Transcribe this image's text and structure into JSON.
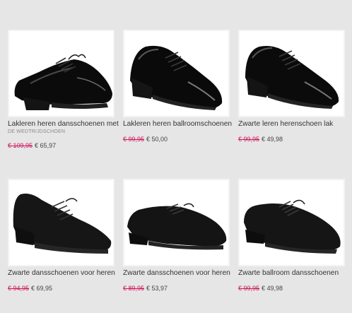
{
  "colors": {
    "sale": "#d1135a",
    "background": "#e6e6e6"
  },
  "products": [
    {
      "title": "Lakleren heren dansschoenen met",
      "subtitle": "DE WEDTRIJDSCHOEN",
      "old_price": "€ 109,95",
      "new_price": "€ 65,97",
      "image": "patent-oxford-shoe"
    },
    {
      "title": "Lakleren heren ballroomschoenen",
      "subtitle": "",
      "old_price": "€ 99,95",
      "new_price": "€ 50,00",
      "image": "patent-ballroom-shoe"
    },
    {
      "title": "Zwarte leren herenschoen lak",
      "subtitle": "",
      "old_price": "€ 99,95",
      "new_price": "€ 49,98",
      "image": "patent-leather-shoe"
    },
    {
      "title": "Zwarte dansschoenen voor heren",
      "subtitle": "",
      "old_price": "€ 94,95",
      "new_price": "€ 69,95",
      "image": "matte-leather-shoe"
    },
    {
      "title": "Zwarte dansschoenen voor heren",
      "subtitle": "",
      "old_price": "€ 89,95",
      "new_price": "€ 53,97",
      "image": "matte-leather-shoe"
    },
    {
      "title": "Zwarte ballroom dansschoenen",
      "subtitle": "",
      "old_price": "€ 99,95",
      "new_price": "€ 49,98",
      "image": "matte-leather-shoe"
    }
  ]
}
